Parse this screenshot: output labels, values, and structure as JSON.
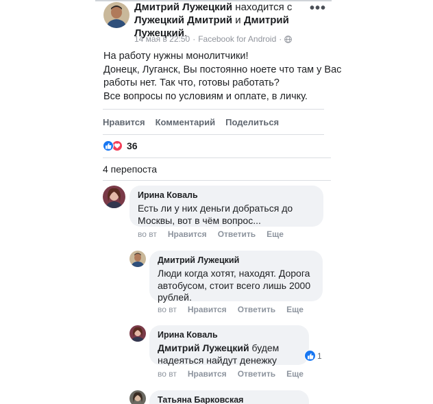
{
  "post": {
    "author": "Дмитрий Лужецкий",
    "with_text": "находится с",
    "tagged_1": "Лужецкий Дмитрий",
    "and_text": "и",
    "tagged_2": "Дмитрий Лужецкий",
    "period": ".",
    "date": "14 мая в 22:50",
    "separator": "·",
    "source": "Facebook for Android",
    "separator_2": "·",
    "more_menu": "•••",
    "text_lines": [
      "На работу нужны монолитчики!",
      "Донецк, Луганск, Вы постоянно ноете что там у Вас",
      "работы нет. Так что, готовы работать?",
      "Все вопросы по условиям и оплате, в личку."
    ],
    "actions": {
      "like": "Нравится",
      "comment": "Комментарий",
      "share": "Поделиться"
    },
    "reactions_count": "36",
    "shares": "4 перепоста"
  },
  "comments": [
    {
      "name": "Ирина Коваль",
      "text": "Есть ли у них деньги добраться до Москвы, вот в чём вопрос...",
      "time": "во вт",
      "like": "Нравится",
      "reply": "Ответить",
      "more": "Еще"
    },
    {
      "name": "Дмитрий Лужецкий",
      "text": "Люди когда хотят, находят. Дорога автобусом, стоит всего лишь 2000 рублей.",
      "time": "во вт",
      "like": "Нравится",
      "reply": "Ответить",
      "more": "Еще"
    },
    {
      "name": "Ирина Коваль",
      "mention": "Дмитрий Лужецкий",
      "text": " будем надеяться найдут денежку",
      "likes": "1",
      "time": "во вт",
      "like": "Нравится",
      "reply": "Ответить",
      "more": "Еще"
    },
    {
      "name": "Татьяна Барковская"
    }
  ],
  "colors": {
    "like_blue": "#1877f2",
    "love_red": "#f33e58",
    "bubble_gray": "#f0f2f5"
  },
  "icons": [
    "like-icon",
    "love-icon",
    "globe-icon",
    "more-icon"
  ]
}
